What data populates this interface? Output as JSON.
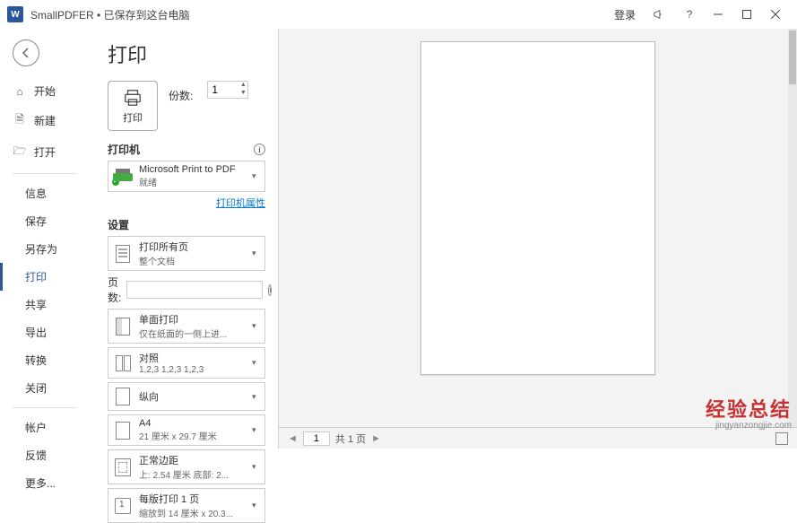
{
  "titlebar": {
    "app_letter": "W",
    "doc_name": "SmallPDFER • 已保存到这台电脑",
    "login": "登录",
    "help": "?"
  },
  "sidebar": {
    "home": "开始",
    "new": "新建",
    "open": "打开",
    "info": "信息",
    "save": "保存",
    "saveas": "另存为",
    "print": "打印",
    "share": "共享",
    "export": "导出",
    "transform": "转换",
    "close": "关闭",
    "account": "帐户",
    "feedback": "反馈",
    "more": "更多..."
  },
  "panel": {
    "title": "打印",
    "print_btn": "打印",
    "copies_label": "份数:",
    "copies_value": "1",
    "printer_header": "打印机",
    "printer_name": "Microsoft Print to PDF",
    "printer_status": "就绪",
    "printer_props": "打印机属性",
    "settings_header": "设置",
    "dd_scope_line1": "打印所有页",
    "dd_scope_line2": "整个文档",
    "pages_label": "页数:",
    "dd_sides_line1": "单面打印",
    "dd_sides_line2": "仅在纸面的一侧上进...",
    "dd_collate_line1": "对照",
    "dd_collate_line2": "1,2,3    1,2,3    1,2,3",
    "dd_orient_line1": "纵向",
    "dd_paper_line1": "A4",
    "dd_paper_line2": "21 厘米 x 29.7 厘米",
    "dd_margin_line1": "正常边距",
    "dd_margin_line2": "上: 2.54 厘米 底部: 2...",
    "dd_pps_line1": "每版打印 1 页",
    "dd_pps_line2": "缩放到 14 厘米 x 20.3..."
  },
  "preview": {
    "page_current": "1",
    "page_total": "共 1 页"
  },
  "watermark": {
    "line1": "经验总结",
    "line2": "jingyanzongjie.com"
  }
}
